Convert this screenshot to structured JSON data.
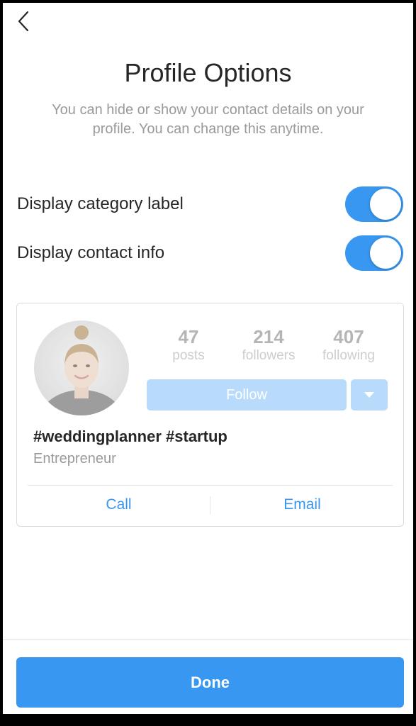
{
  "header": {
    "back_icon": "chevron-left-icon",
    "title": "Profile Options",
    "subtitle": "You can hide or show your contact details on your profile. You can change this anytime."
  },
  "settings": [
    {
      "label": "Display category label",
      "enabled": true
    },
    {
      "label": "Display contact info",
      "enabled": true
    }
  ],
  "preview": {
    "stats": [
      {
        "count": "47",
        "label": "posts"
      },
      {
        "count": "214",
        "label": "followers"
      },
      {
        "count": "407",
        "label": "following"
      }
    ],
    "follow_label": "Follow",
    "dropdown_icon": "caret-down-icon",
    "bio_name": "#weddingplanner #startup",
    "bio_category": "Entrepreneur",
    "contact_actions": {
      "call": "Call",
      "email": "Email"
    }
  },
  "footer": {
    "done_label": "Done"
  },
  "colors": {
    "accent": "#3897f0",
    "follow_disabled": "#b9dbfb",
    "text": "#262626",
    "muted": "#9a9a9a"
  }
}
